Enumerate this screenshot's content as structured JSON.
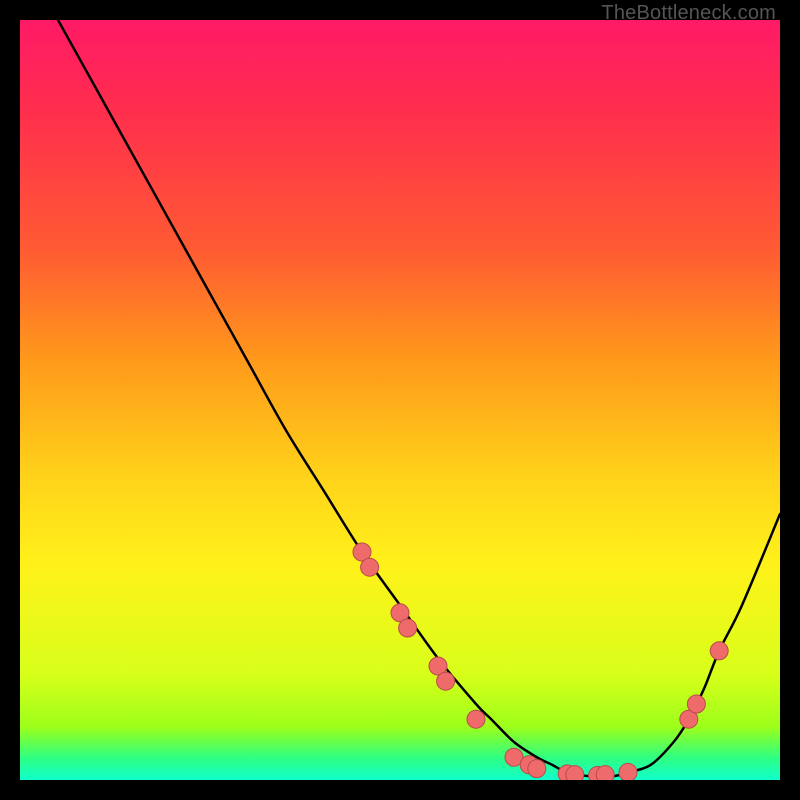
{
  "attribution": "TheBottleneck.com",
  "colors": {
    "frame_bg": "#000000",
    "curve_stroke": "#000000",
    "marker_fill": "#ef6b6b",
    "marker_stroke": "#b84a4a"
  },
  "chart_data": {
    "type": "line",
    "title": "",
    "subtitle": "",
    "xlabel": "",
    "ylabel": "",
    "xlim": [
      0,
      100
    ],
    "ylim": [
      0,
      100
    ],
    "grid": false,
    "legend": false,
    "series": [
      {
        "name": "bottleneck-curve",
        "comment": "V-shaped curve; y estimated visually on 0–100 scale (0 = bottom of plot).",
        "x": [
          5,
          10,
          15,
          20,
          25,
          30,
          35,
          40,
          45,
          50,
          55,
          60,
          62,
          65,
          68,
          70,
          72,
          75,
          78,
          80,
          83,
          86,
          88,
          90,
          92,
          95,
          100
        ],
        "y": [
          100,
          91,
          82,
          73,
          64,
          55,
          46,
          38,
          30,
          23,
          16,
          10,
          8,
          5,
          3,
          2,
          1,
          0.5,
          0.5,
          1,
          2,
          5,
          8,
          12,
          17,
          23,
          35
        ]
      }
    ],
    "markers": [
      {
        "name": "highlight-points",
        "comment": "Salmon circles along the curve near the trough and right slope.",
        "points": [
          {
            "x": 45,
            "y": 30
          },
          {
            "x": 46,
            "y": 28
          },
          {
            "x": 50,
            "y": 22
          },
          {
            "x": 51,
            "y": 20
          },
          {
            "x": 55,
            "y": 15
          },
          {
            "x": 56,
            "y": 13
          },
          {
            "x": 60,
            "y": 8
          },
          {
            "x": 65,
            "y": 3
          },
          {
            "x": 67,
            "y": 2
          },
          {
            "x": 68,
            "y": 1.5
          },
          {
            "x": 72,
            "y": 0.8
          },
          {
            "x": 73,
            "y": 0.7
          },
          {
            "x": 76,
            "y": 0.6
          },
          {
            "x": 77,
            "y": 0.7
          },
          {
            "x": 80,
            "y": 1
          },
          {
            "x": 88,
            "y": 8
          },
          {
            "x": 89,
            "y": 10
          },
          {
            "x": 92,
            "y": 17
          }
        ]
      }
    ]
  }
}
